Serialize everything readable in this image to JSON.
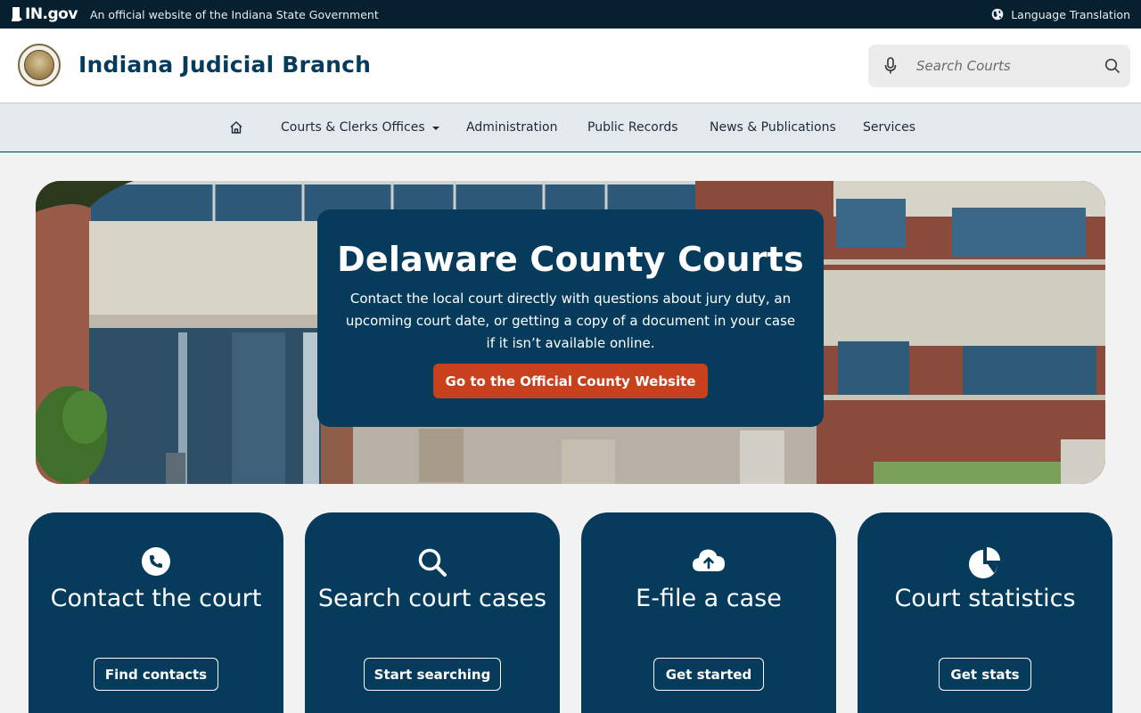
{
  "gov_banner": {
    "logo": "IN.gov",
    "text": "An official website of the Indiana State Government",
    "language": "Language Translation"
  },
  "header": {
    "title": "Indiana Judicial Branch",
    "search_placeholder": "Search Courts"
  },
  "nav": {
    "items": [
      {
        "label": "Courts & Clerks Offices"
      },
      {
        "label": "Administration"
      },
      {
        "label": "Public Records"
      },
      {
        "label": "News & Publications"
      },
      {
        "label": "Services"
      }
    ]
  },
  "hero": {
    "title": "Delaware County Courts",
    "description": "Contact the local court directly with questions about jury duty, an upcoming court date, or getting a copy of a document in your case if it isn’t available online.",
    "button": "Go to the Official County Website"
  },
  "cards": [
    {
      "title": "Contact the court",
      "button": "Find contacts",
      "icon": "phone-icon"
    },
    {
      "title": "Search court cases",
      "button": "Start searching",
      "icon": "search-icon"
    },
    {
      "title": "E-file a case",
      "button": "Get started",
      "icon": "cloud-upload-icon"
    },
    {
      "title": "Court statistics",
      "button": "Get stats",
      "icon": "pie-chart-icon"
    }
  ],
  "colors": {
    "brand_navy": "#073b5c",
    "banner_dark": "#06202f",
    "accent_orange": "#c8401c",
    "nav_bg": "#e4e9ee"
  }
}
